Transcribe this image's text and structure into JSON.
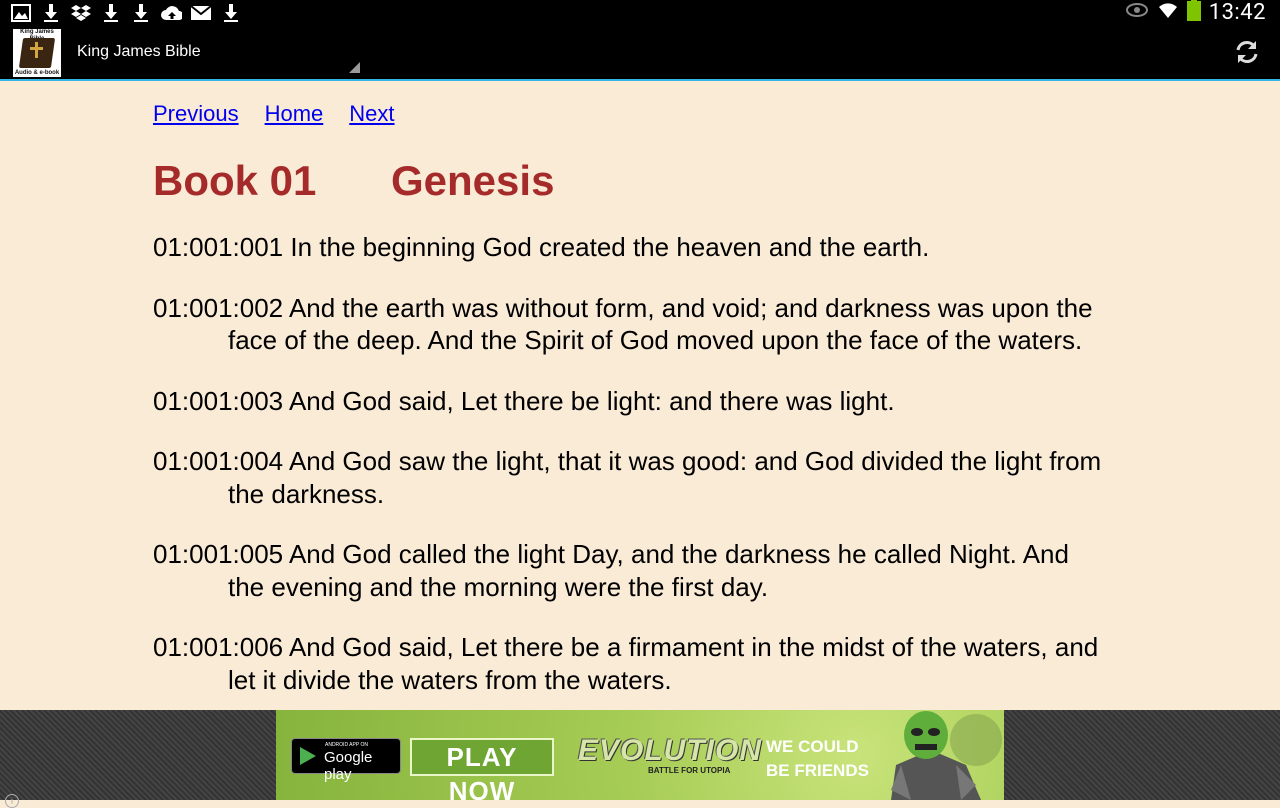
{
  "status_bar": {
    "left_icons": [
      "image-icon",
      "download-icon",
      "dropbox-icon",
      "download-icon",
      "download-icon",
      "cloud-upload-icon",
      "gmail-icon",
      "download-icon"
    ],
    "right_icons": [
      "eye-icon",
      "wifi-icon",
      "battery-icon"
    ],
    "time": "13:42"
  },
  "action_bar": {
    "app_icon_top_text": "King James Bible",
    "app_icon_bottom_text": "Audio & e-book",
    "title": "King James Bible",
    "refresh_icon": "refresh-icon"
  },
  "nav": {
    "previous": "Previous",
    "home": "Home",
    "next": "Next"
  },
  "heading": {
    "book_number": "Book 01",
    "book_name": "Genesis"
  },
  "verses": [
    {
      "ref": "01:001:001",
      "text": "In the beginning God created the heaven and the earth."
    },
    {
      "ref": "01:001:002",
      "text": "And the earth was without form, and void; and darkness was upon the face of the deep. And the Spirit of God moved upon the face of the waters."
    },
    {
      "ref": "01:001:003",
      "text": "And God said, Let there be light: and there was light."
    },
    {
      "ref": "01:001:004",
      "text": "And God saw the light, that it was good: and God divided the light from the darkness."
    },
    {
      "ref": "01:001:005",
      "text": "And God called the light Day, and the darkness he called Night. And the evening and the morning were the first day."
    },
    {
      "ref": "01:001:006",
      "text": "And God said, Let there be a firmament in the midst of the waters, and let it divide the waters from the waters."
    }
  ],
  "ad": {
    "gp_small": "ANDROID APP ON",
    "gp_big": "Google play",
    "play_now": "PLAY NOW",
    "game_title": "EVOLUTION",
    "game_subtitle": "BATTLE FOR UTOPIA",
    "tagline_1": "WE COULD",
    "tagline_2": "BE FRIENDS",
    "info": "i"
  }
}
